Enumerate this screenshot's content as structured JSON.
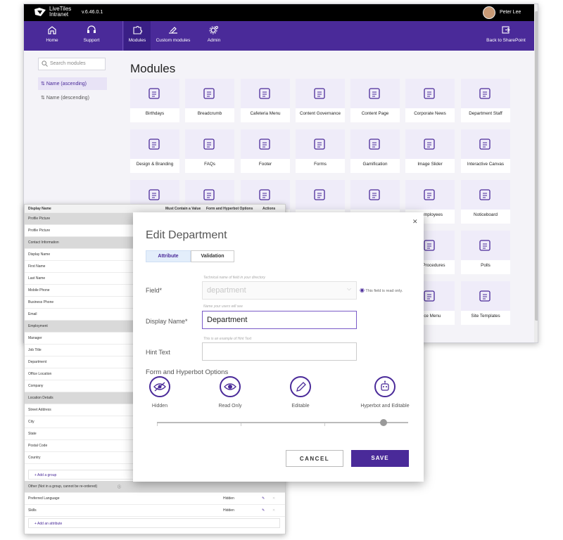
{
  "app": {
    "brand_line1": "LiveTiles",
    "brand_line2": "Intranet",
    "version": "v.6.46.0.1",
    "user_name": "Peter Lee"
  },
  "nav": {
    "home": "Home",
    "support": "Support",
    "modules": "Modules",
    "custom_modules": "Custom modules",
    "admin": "Admin",
    "back": "Back to SharePoint"
  },
  "sidebar": {
    "search_placeholder": "Search modules",
    "sort_asc": "Name (ascending)",
    "sort_desc": "Name (descending)"
  },
  "main": {
    "title": "Modules",
    "modules": [
      "Birthdays",
      "Breadcrumb",
      "Cafeteria Menu",
      "Content Governance",
      "Content Page",
      "Corporate News",
      "Department Staff",
      "Design & Branding",
      "FAQs",
      "Footer",
      "Forms",
      "Gamification",
      "Image Slider",
      "Interactive Canvas",
      "",
      "",
      "",
      "",
      "",
      "y Employees",
      "Noticeboard",
      "",
      "",
      "",
      "",
      "",
      "s & Procedures",
      "Polls",
      "",
      "",
      "",
      "",
      "",
      "rvice Menu",
      "Site Templates"
    ]
  },
  "table": {
    "headers": {
      "display_name": "Display Name",
      "must_contain": "Must Contain a Value",
      "options": "Form and Hyperbot Options",
      "actions": "Actions"
    },
    "rows": [
      {
        "label": "Profile Picture",
        "group": true
      },
      {
        "label": "Profile Picture",
        "group": false
      },
      {
        "label": "Contact Information",
        "group": true
      },
      {
        "label": "Display Name",
        "group": false
      },
      {
        "label": "First Name",
        "group": false
      },
      {
        "label": "Last Name",
        "group": false
      },
      {
        "label": "Mobile Phone",
        "group": false
      },
      {
        "label": "Business Phone",
        "group": false
      },
      {
        "label": "Email",
        "group": false
      },
      {
        "label": "Employment",
        "group": true
      },
      {
        "label": "Manager",
        "group": false
      },
      {
        "label": "Job Title",
        "group": false
      },
      {
        "label": "Department",
        "group": false
      },
      {
        "label": "Office Location",
        "group": false
      },
      {
        "label": "Company",
        "group": false
      },
      {
        "label": "Location Details",
        "group": true
      },
      {
        "label": "Street Address",
        "group": false
      },
      {
        "label": "City",
        "group": false
      },
      {
        "label": "State",
        "group": false
      },
      {
        "label": "Postal Code",
        "group": false
      },
      {
        "label": "Country",
        "group": false
      }
    ],
    "add_group": "+ Add a group",
    "other_group": "Other (Not in a group, cannot be re-ordered)",
    "other_rows": [
      {
        "label": "Preferred Language",
        "option": "Hidden"
      },
      {
        "label": "Skills",
        "option": "Hidden"
      }
    ],
    "add_attribute": "+ Add an attribute"
  },
  "dialog": {
    "title": "Edit Department",
    "tab_attribute": "Attribute",
    "tab_validation": "Validation",
    "field_label": "Field*",
    "field_hint": "Technical name of field in your directory",
    "field_value": "department",
    "readonly_note": "This field is read only.",
    "display_label": "Display Name*",
    "display_hint": "Name your users will see",
    "display_value": "Department",
    "hint_label": "Hint Text",
    "hint_hint": "This is an example of Hint Text",
    "hint_value": "",
    "options_heading": "Form and Hyperbot Options",
    "options": [
      "Hidden",
      "Read Only",
      "Editable",
      "Hyperbot and Editable"
    ],
    "selected_option": "Hyperbot and Editable",
    "cancel": "CANCEL",
    "save": "SAVE"
  },
  "colors": {
    "accent": "#4a2a99",
    "topbar": "#000000",
    "tile_bg": "#efecf9"
  }
}
